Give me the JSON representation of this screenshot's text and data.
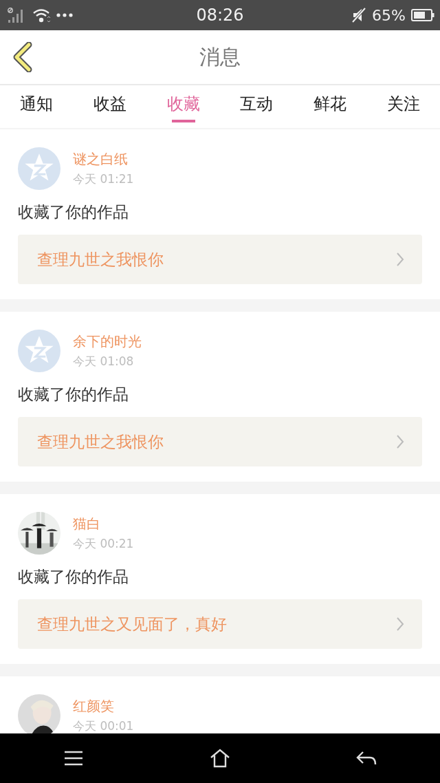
{
  "status_bar": {
    "time": "08:26",
    "battery": "65%"
  },
  "header": {
    "title": "消息"
  },
  "tabs": [
    {
      "label": "通知",
      "selected": false
    },
    {
      "label": "收益",
      "selected": false
    },
    {
      "label": "收藏",
      "selected": true
    },
    {
      "label": "互动",
      "selected": false
    },
    {
      "label": "鲜花",
      "selected": false
    },
    {
      "label": "关注",
      "selected": false
    }
  ],
  "messages": [
    {
      "kind": "default",
      "name": "谜之白纸",
      "time": "今天 01:21",
      "action": "收藏了你的作品",
      "work": "查理九世之我恨你"
    },
    {
      "kind": "default",
      "name": "余下的时光",
      "time": "今天 01:08",
      "action": "收藏了你的作品",
      "work": "查理九世之我恨你"
    },
    {
      "kind": "picture",
      "name": "猫白",
      "time": "今天 00:21",
      "action": "收藏了你的作品",
      "work": "查理九世之又见面了，真好"
    },
    {
      "kind": "portrait",
      "name": "红颜笑",
      "time": "今天 00:01"
    }
  ]
}
